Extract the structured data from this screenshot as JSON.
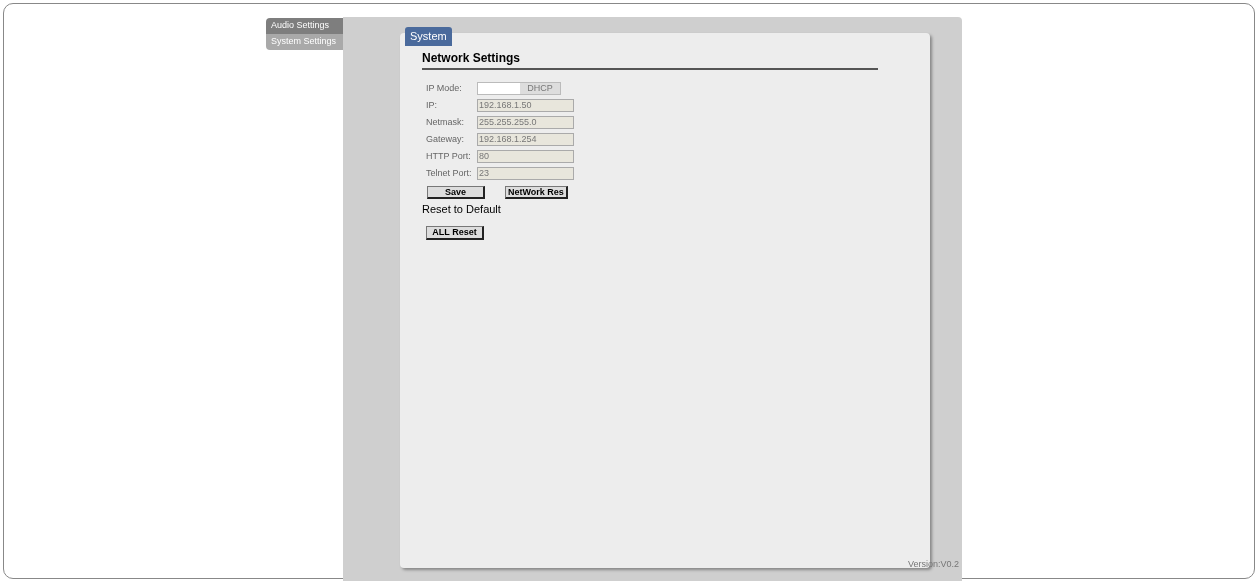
{
  "sidebar": {
    "items": [
      {
        "label": "Audio Settings",
        "selected": false
      },
      {
        "label": "System Settings",
        "selected": true
      }
    ]
  },
  "tab": {
    "label": "System",
    "selected": true
  },
  "section_title": "Network Settings",
  "ip_mode": {
    "label": "IP Mode:",
    "value": "DHCP",
    "on": false
  },
  "fields": [
    {
      "label": "IP:",
      "value": "192.168.1.50"
    },
    {
      "label": "Netmask:",
      "value": "255.255.255.0"
    },
    {
      "label": "Gateway:",
      "value": "192.168.1.254"
    },
    {
      "label": "HTTP Port:",
      "value": "80"
    },
    {
      "label": "Telnet Port:",
      "value": "23"
    }
  ],
  "buttons": [
    "Save",
    "NetWork Res"
  ],
  "reset_title": "Reset to Default",
  "reset_button": "ALL Reset",
  "version": "Version:V0.2"
}
